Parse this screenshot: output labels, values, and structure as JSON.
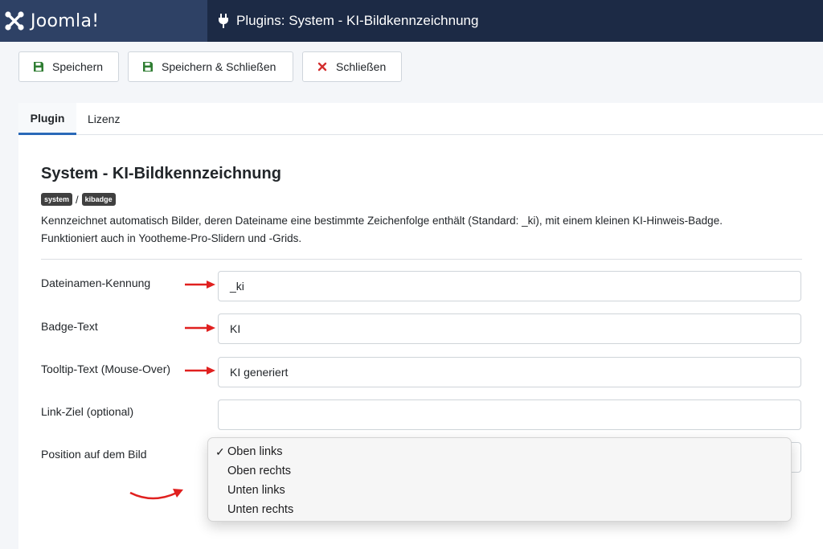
{
  "header": {
    "logo_text": "Joomla!",
    "page_title": "Plugins: System - KI-Bildkennzeichnung",
    "logo_icon": "joomla-logo-icon",
    "title_icon": "plug-icon"
  },
  "toolbar": {
    "save_label": "Speichern",
    "save_close_label": "Speichern & Schließen",
    "close_label": "Schließen",
    "save_icon": "floppy-disk-icon",
    "close_icon": "close-icon"
  },
  "tabs": [
    {
      "label": "Plugin",
      "active": true
    },
    {
      "label": "Lizenz",
      "active": false
    }
  ],
  "plugin": {
    "title": "System - KI-Bildkennzeichnung",
    "badges": [
      "system",
      "kibadge"
    ],
    "separator": "/",
    "description_line1": "Kennzeichnet automatisch Bilder, deren Dateiname eine bestimmte Zeichenfolge enthält (Standard: _ki), mit einem kleinen KI-Hinweis-Badge.",
    "description_line2": "Funktioniert auch in Yootheme-Pro-Slidern und -Grids."
  },
  "fields": {
    "filename_id": {
      "label": "Dateinamen-Kennung",
      "value": "_ki"
    },
    "badge_text": {
      "label": "Badge-Text",
      "value": "KI"
    },
    "tooltip_text": {
      "label": "Tooltip-Text (Mouse-Over)",
      "value": "KI generiert"
    },
    "link_target": {
      "label": "Link-Ziel (optional)",
      "value": ""
    },
    "position": {
      "label": "Position auf dem Bild",
      "selected": "Oben links",
      "check": "✓",
      "options": [
        "Oben links",
        "Oben rechts",
        "Unten links",
        "Unten rechts"
      ]
    }
  },
  "colors": {
    "header_bg": "#1c2a45",
    "logo_bg": "#2e4165",
    "save_icon": "#2f7d32",
    "close_icon": "#d32f2f",
    "annotation_arrow": "#e0201f",
    "tab_active": "#2a69b8"
  }
}
